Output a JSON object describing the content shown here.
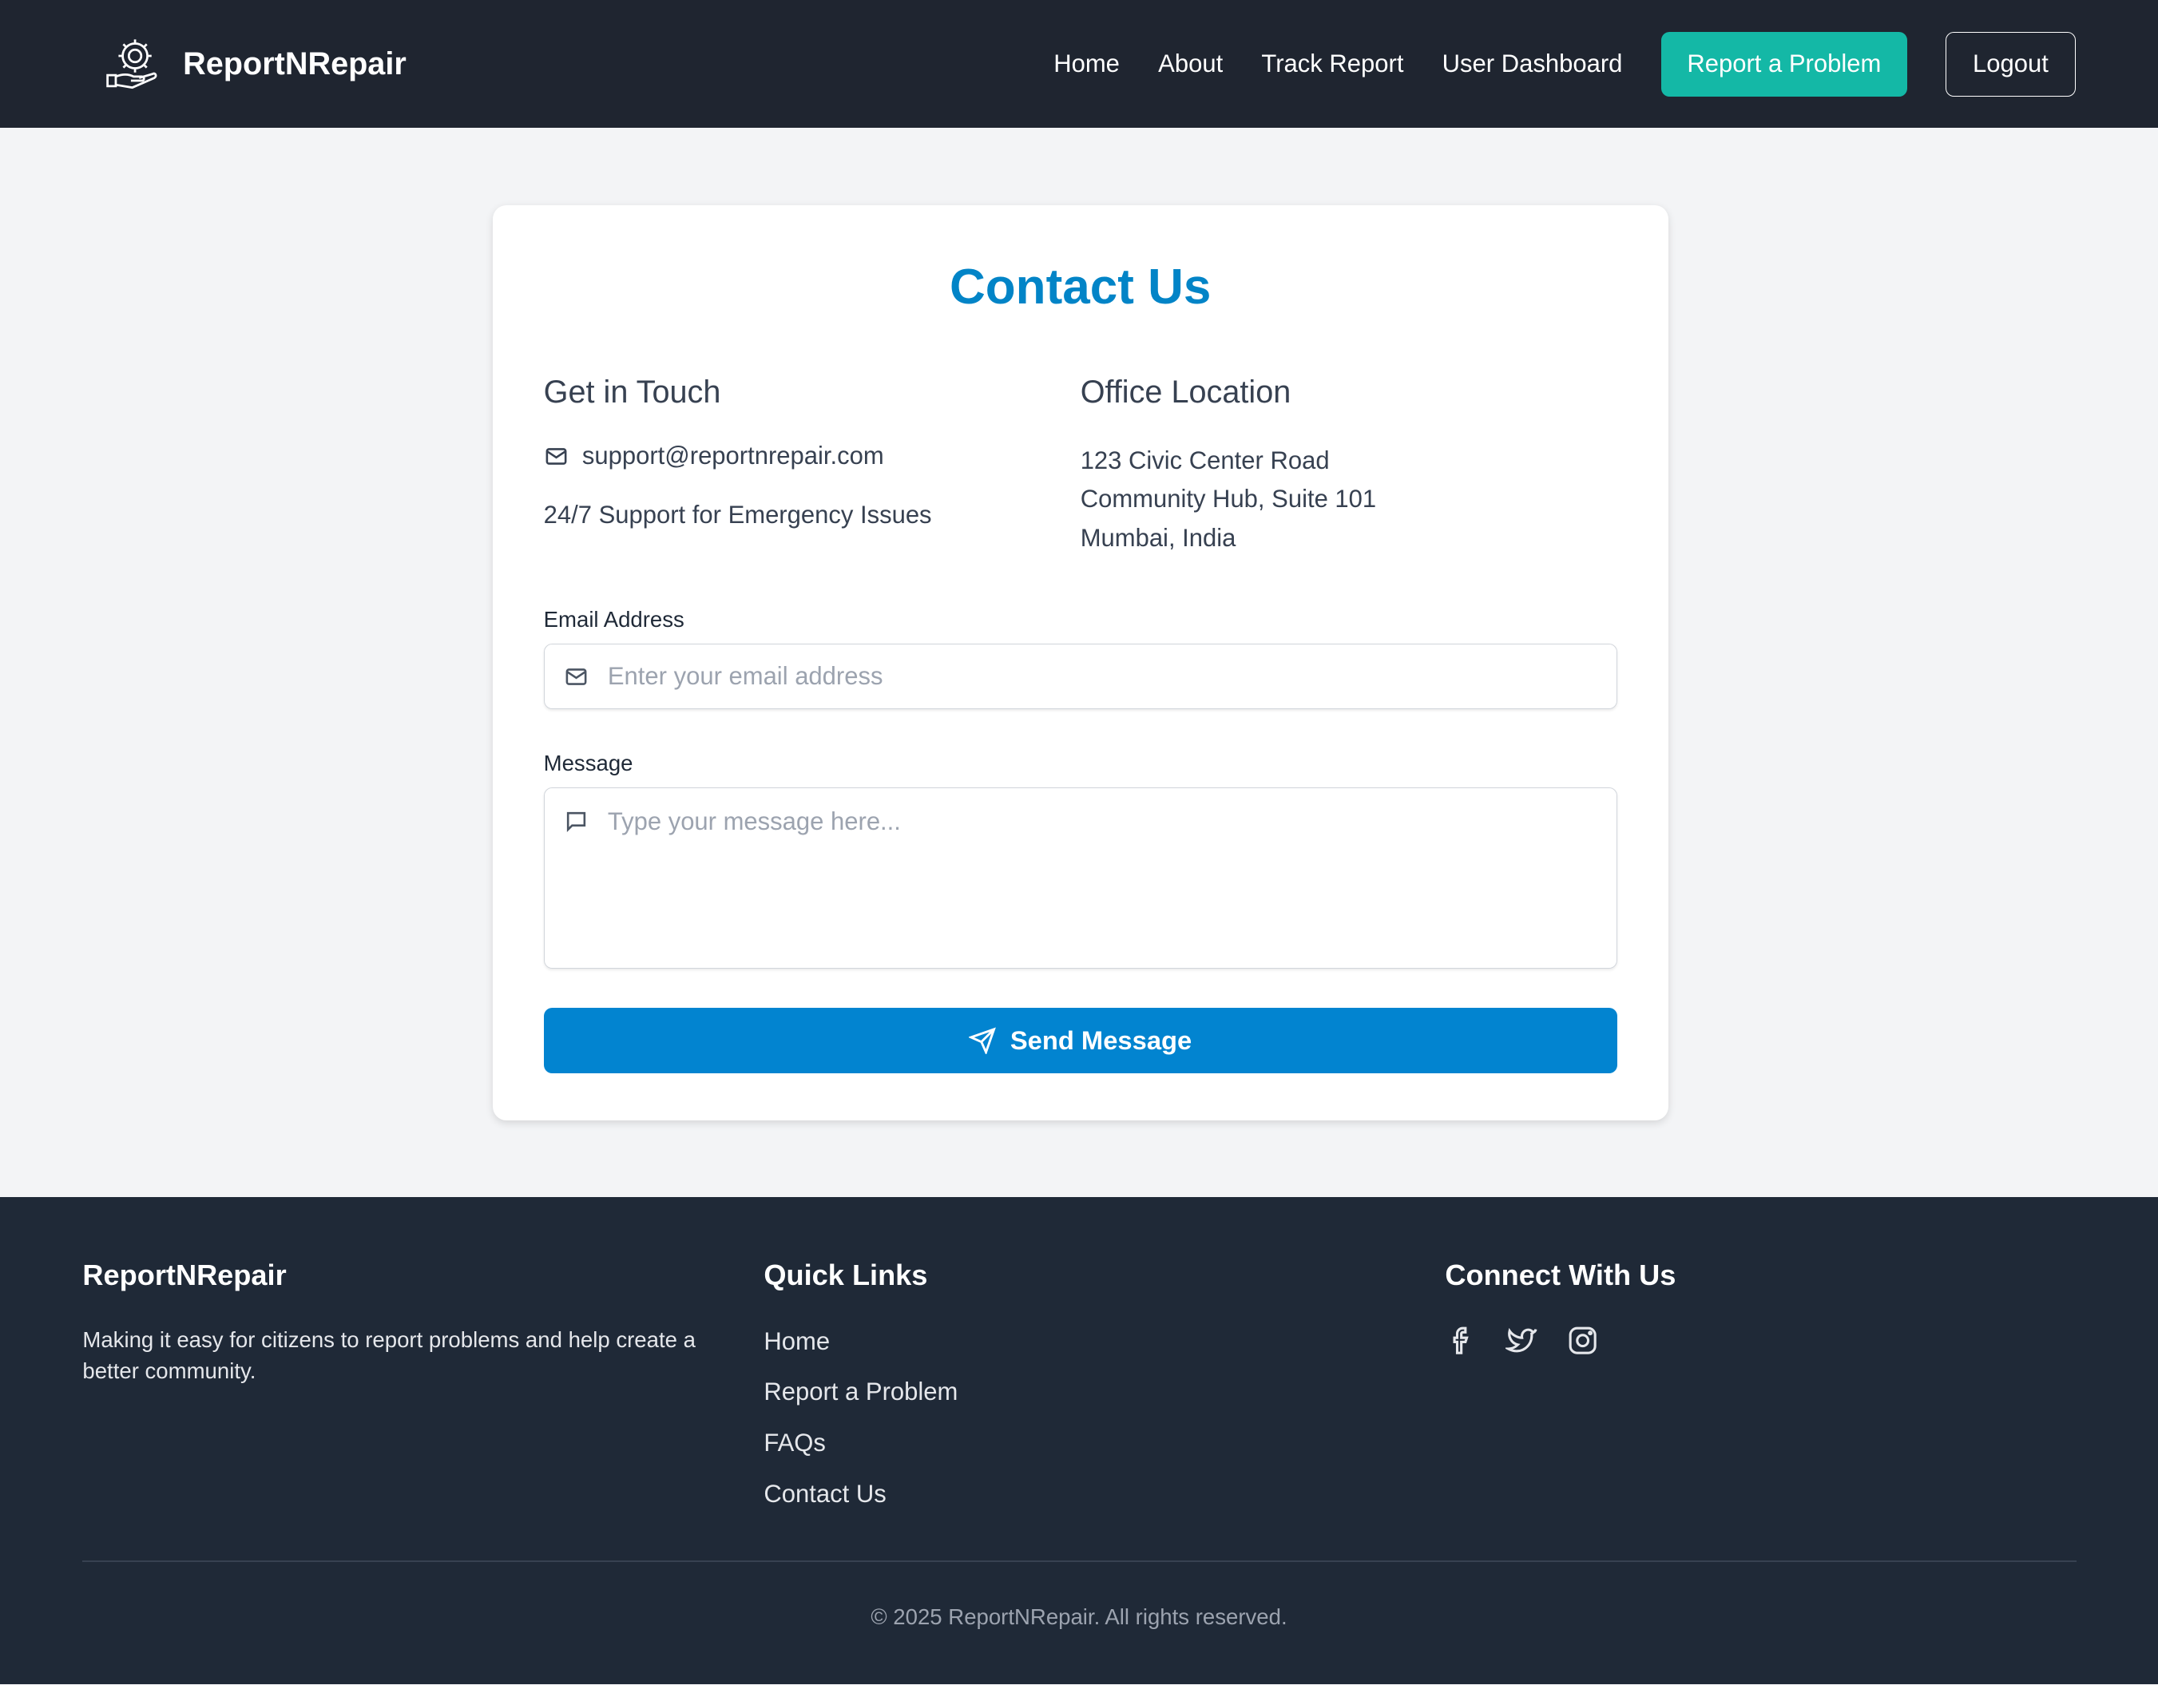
{
  "nav": {
    "brand": "ReportNRepair",
    "links": [
      "Home",
      "About",
      "Track Report",
      "User Dashboard"
    ],
    "report_label": "Report a Problem",
    "logout_label": "Logout"
  },
  "contact": {
    "title": "Contact Us",
    "get_in_touch": {
      "heading": "Get in Touch",
      "email": "support@reportnrepair.com",
      "support": "24/7 Support for Emergency Issues"
    },
    "office": {
      "heading": "Office Location",
      "lines": [
        "123 Civic Center Road",
        "Community Hub, Suite 101",
        "Mumbai, India"
      ]
    },
    "form": {
      "email_label": "Email Address",
      "email_placeholder": "Enter your email address",
      "message_label": "Message",
      "message_placeholder": "Type your message here...",
      "send_label": "Send Message"
    }
  },
  "footer": {
    "brand": "ReportNRepair",
    "tagline": "Making it easy for citizens to report problems and help create a better community.",
    "quick_links_heading": "Quick Links",
    "quick_links": [
      "Home",
      "Report a Problem",
      "FAQs",
      "Contact Us"
    ],
    "connect_heading": "Connect With Us",
    "socials": [
      "facebook-icon",
      "twitter-icon",
      "instagram-icon"
    ],
    "copyright": "© 2025 ReportNRepair. All rights reserved."
  },
  "colors": {
    "nav_bg": "#1f2530",
    "accent_teal": "#14b8a6",
    "accent_blue": "#0284c7",
    "footer_bg": "#1f2937"
  }
}
